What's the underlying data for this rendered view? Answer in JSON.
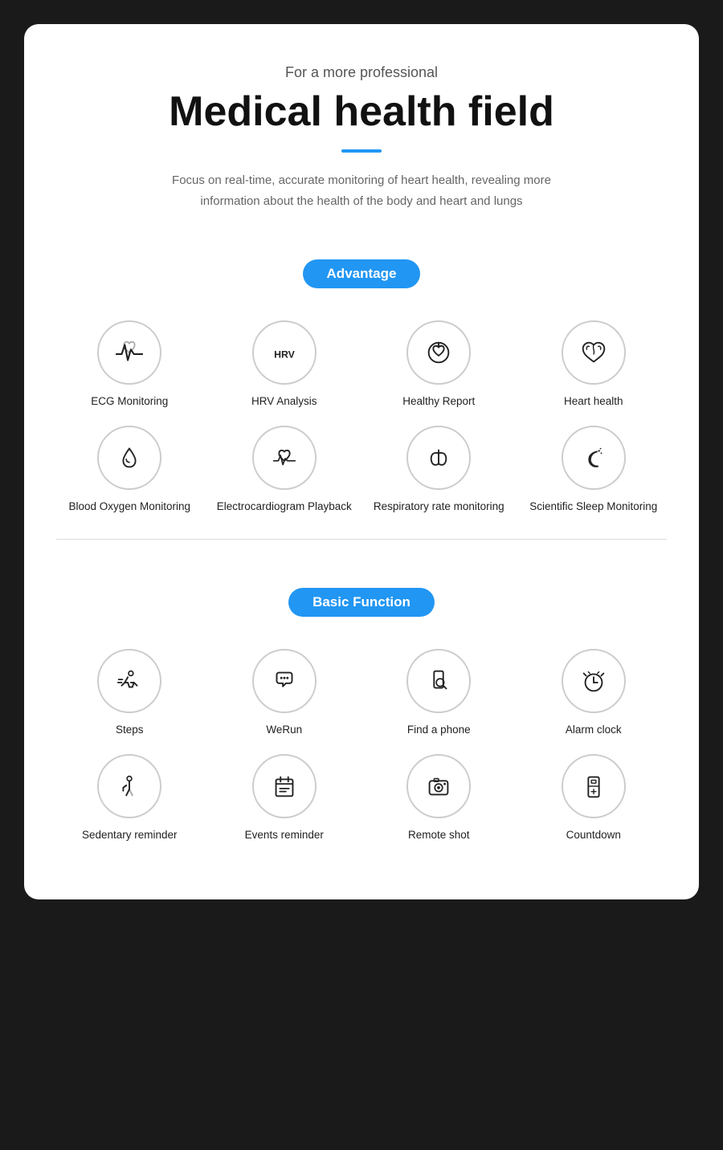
{
  "header": {
    "subtitle": "For a more professional",
    "title": "Medical health field",
    "description": "Focus on real-time, accurate monitoring of heart health, revealing more information about the health of the body and heart and lungs"
  },
  "sections": [
    {
      "badge": "Advantage",
      "features": [
        {
          "id": "ecg",
          "label": "ECG Monitoring"
        },
        {
          "id": "hrv",
          "label": "HRV Analysis"
        },
        {
          "id": "healthy-report",
          "label": "Healthy Report"
        },
        {
          "id": "heart-health",
          "label": "Heart health"
        },
        {
          "id": "blood-oxygen",
          "label": "Blood Oxygen Monitoring"
        },
        {
          "id": "ecg-playback",
          "label": "Electrocardiogram Playback"
        },
        {
          "id": "respiratory",
          "label": "Respiratory rate monitoring"
        },
        {
          "id": "sleep",
          "label": "Scientific Sleep Monitoring"
        }
      ]
    },
    {
      "badge": "Basic Function",
      "features": [
        {
          "id": "steps",
          "label": "Steps"
        },
        {
          "id": "werun",
          "label": "WeRun"
        },
        {
          "id": "find-phone",
          "label": "Find a phone"
        },
        {
          "id": "alarm",
          "label": "Alarm clock"
        },
        {
          "id": "sedentary",
          "label": "Sedentary reminder"
        },
        {
          "id": "events",
          "label": "Events reminder"
        },
        {
          "id": "remote-shot",
          "label": "Remote shot"
        },
        {
          "id": "countdown",
          "label": "Countdown"
        }
      ]
    }
  ]
}
